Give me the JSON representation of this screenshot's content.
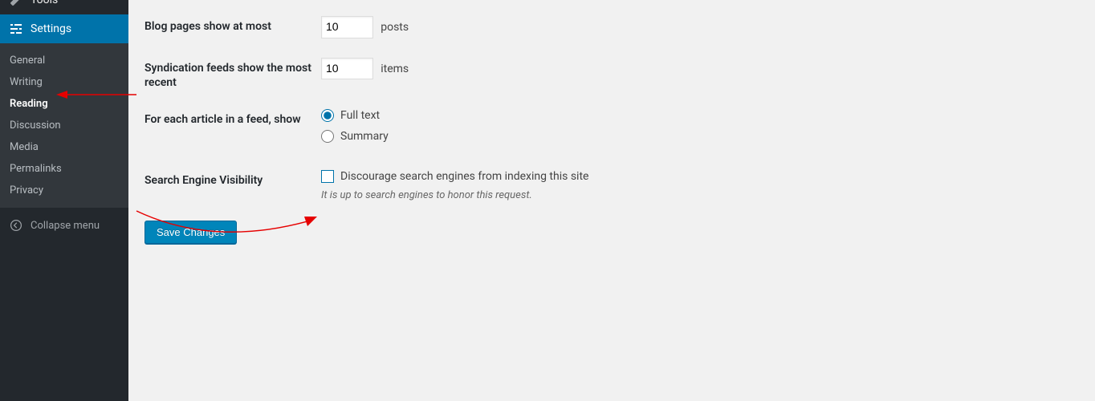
{
  "sidebar": {
    "tools_label": "Tools",
    "settings_label": "Settings",
    "submenu": {
      "general": "General",
      "writing": "Writing",
      "reading": "Reading",
      "discussion": "Discussion",
      "media": "Media",
      "permalinks": "Permalinks",
      "privacy": "Privacy"
    },
    "collapse_label": "Collapse menu"
  },
  "form": {
    "blog_pages_label": "Blog pages show at most",
    "blog_pages_value": "10",
    "blog_pages_unit": "posts",
    "syndication_label": "Syndication feeds show the most recent",
    "syndication_value": "10",
    "syndication_unit": "items",
    "feed_show_label": "For each article in a feed, show",
    "feed_full_text": "Full text",
    "feed_summary": "Summary",
    "seo_label": "Search Engine Visibility",
    "seo_checkbox_label": "Discourage search engines from indexing this site",
    "seo_description": "It is up to search engines to honor this request.",
    "save_button": "Save Changes"
  }
}
